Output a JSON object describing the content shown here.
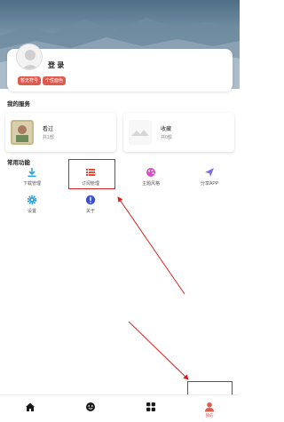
{
  "profile": {
    "login_label": "登 录",
    "tags": [
      "暂无符号",
      "个性面色"
    ]
  },
  "services": {
    "title": "我的服务",
    "items": [
      {
        "title": "看过",
        "subtitle": "共1部"
      },
      {
        "title": "收藏",
        "subtitle": "共0部"
      }
    ]
  },
  "functions": {
    "title": "常用功能",
    "items": [
      {
        "label": "下载管理",
        "icon": "download-icon",
        "color": "#2aa6d8"
      },
      {
        "label": "订阅管理",
        "icon": "list-icon",
        "color": "#e24a3a"
      },
      {
        "label": "主题风格",
        "icon": "palette-icon",
        "color": "#d54fc4"
      },
      {
        "label": "分享APP",
        "icon": "send-icon",
        "color": "#7b6be6"
      },
      {
        "label": "设置",
        "icon": "gear-icon",
        "color": "#2a9ad8"
      },
      {
        "label": "关于",
        "icon": "info-icon",
        "color": "#3b4fd6"
      }
    ]
  },
  "tabbar": {
    "items": [
      {
        "icon": "home-icon"
      },
      {
        "icon": "smile-icon"
      },
      {
        "icon": "grid-icon"
      },
      {
        "icon": "person-icon",
        "label": "我的",
        "active": true
      }
    ]
  },
  "accent_color": "#e05a4e",
  "annotation_color": "#d92020"
}
